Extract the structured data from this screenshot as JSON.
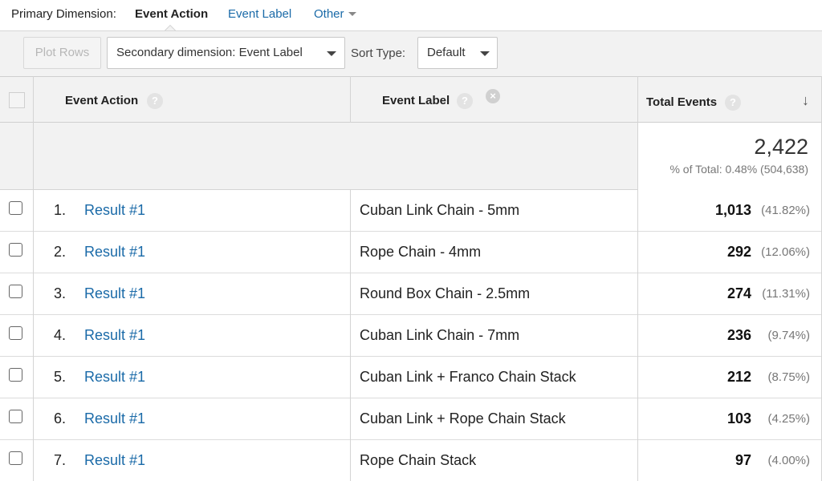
{
  "dimension_bar": {
    "label": "Primary Dimension:",
    "active": "Event Action",
    "link_event_label": "Event Label",
    "link_other": "Other"
  },
  "toolbar": {
    "plot_rows": "Plot Rows",
    "secondary_dimension": "Secondary dimension: Event Label",
    "sort_type_label": "Sort Type:",
    "sort_type_value": "Default"
  },
  "table": {
    "headers": {
      "event_action": "Event Action",
      "event_label": "Event Label",
      "total_events": "Total Events"
    },
    "help_glyph": "?",
    "remove_glyph": "×",
    "sort_glyph": "↓",
    "totals": {
      "value": "2,422",
      "note": "% of Total: 0.48% (504,638)"
    },
    "rows": [
      {
        "num": "1.",
        "action": "Result #1",
        "label": "Cuban Link Chain - 5mm",
        "value": "1,013",
        "pct": "(41.82%)"
      },
      {
        "num": "2.",
        "action": "Result #1",
        "label": "Rope Chain - 4mm",
        "value": "292",
        "pct": "(12.06%)"
      },
      {
        "num": "3.",
        "action": "Result #1",
        "label": "Round Box Chain - 2.5mm",
        "value": "274",
        "pct": "(11.31%)"
      },
      {
        "num": "4.",
        "action": "Result #1",
        "label": "Cuban Link Chain - 7mm",
        "value": "236",
        "pct": "(9.74%)"
      },
      {
        "num": "5.",
        "action": "Result #1",
        "label": "Cuban Link + Franco Chain Stack",
        "value": "212",
        "pct": "(8.75%)"
      },
      {
        "num": "6.",
        "action": "Result #1",
        "label": "Cuban Link + Rope Chain Stack",
        "value": "103",
        "pct": "(4.25%)"
      },
      {
        "num": "7.",
        "action": "Result #1",
        "label": "Rope Chain Stack",
        "value": "97",
        "pct": "(4.00%)"
      }
    ]
  },
  "colors": {
    "link": "#1a6aa8",
    "header_bg": "#f2f2f2"
  }
}
